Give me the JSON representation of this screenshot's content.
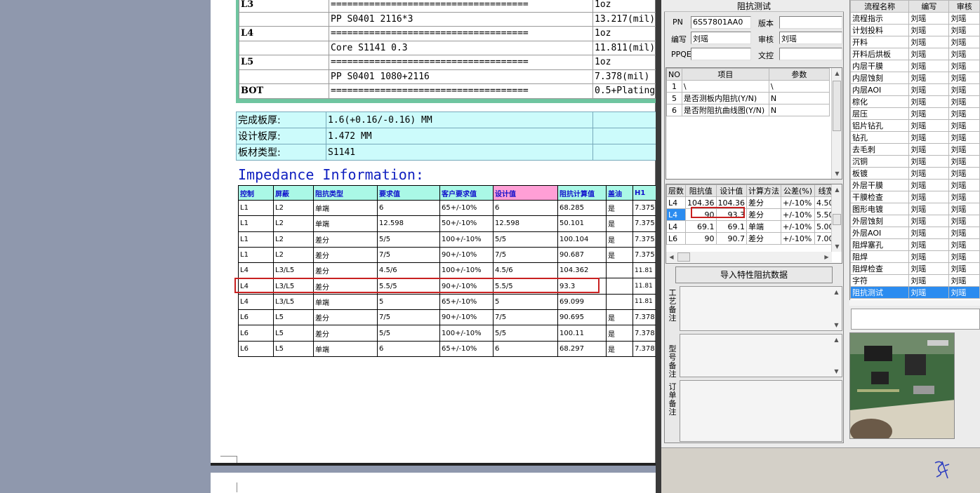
{
  "stackup": {
    "rows": [
      {
        "layer": "L3",
        "material": "====================================",
        "value": "1oz"
      },
      {
        "layer": "",
        "material": "PP     S0401    2116*3",
        "value": "13.217(mil)"
      },
      {
        "layer": "L4",
        "material": "====================================",
        "value": "1oz"
      },
      {
        "layer": "",
        "material": "Core     S1141     0.3",
        "value": "11.811(mil)"
      },
      {
        "layer": "L5",
        "material": "====================================",
        "value": "1oz"
      },
      {
        "layer": "",
        "material": "PP     S0401     1080+2116",
        "value": "7.378(mil)"
      },
      {
        "layer": "BOT",
        "material": "====================================",
        "value": "0.5+Plating"
      }
    ]
  },
  "thickness": {
    "rows": [
      {
        "label": "完成板厚:",
        "value": "1.6(+0.16/-0.16) MM"
      },
      {
        "label": "设计板厚:",
        "value": "1.472 MM"
      },
      {
        "label": "板材类型:",
        "value": "S1141"
      }
    ]
  },
  "impedance": {
    "title": "Impedance Information:",
    "headers": [
      "控制",
      "屏蔽",
      "阻抗类型",
      "要求值",
      "客户要求值",
      "设计值",
      "阻抗计算值",
      "盖油",
      "H1"
    ],
    "rows": [
      [
        "L1",
        "L2",
        "单端",
        "6",
        "65+/-10%",
        "6",
        "68.285",
        "是",
        "7.375"
      ],
      [
        "L1",
        "L2",
        "单端",
        "12.598",
        "50+/-10%",
        "12.598",
        "50.101",
        "是",
        "7.375"
      ],
      [
        "L1",
        "L2",
        "差分",
        "5/5",
        "100+/-10%",
        "5/5",
        "100.104",
        "是",
        "7.375"
      ],
      [
        "L1",
        "L2",
        "差分",
        "7/5",
        "90+/-10%",
        "7/5",
        "90.687",
        "是",
        "7.375"
      ],
      [
        "L4",
        "L3/L5",
        "差分",
        "4.5/6",
        "100+/-10%",
        "4.5/6",
        "104.362",
        "",
        "11.81"
      ],
      [
        "L4",
        "L3/L5",
        "差分",
        "5.5/5",
        "90+/-10%",
        "5.5/5",
        "93.3",
        "",
        "11.81"
      ],
      [
        "L4",
        "L3/L5",
        "单端",
        "5",
        "65+/-10%",
        "5",
        "69.099",
        "",
        "11.81"
      ],
      [
        "L6",
        "L5",
        "差分",
        "7/5",
        "90+/-10%",
        "7/5",
        "90.695",
        "是",
        "7.378"
      ],
      [
        "L6",
        "L5",
        "差分",
        "5/5",
        "100+/-10%",
        "5/5",
        "100.11",
        "是",
        "7.378"
      ],
      [
        "L6",
        "L5",
        "单端",
        "6",
        "65+/-10%",
        "6",
        "68.297",
        "是",
        "7.378"
      ]
    ]
  },
  "form": {
    "title": "阻抗测试",
    "pn_label": "PN",
    "pn_value": "6S57801AA0",
    "version_label": "版本",
    "version_value": "",
    "author_label": "编写",
    "author_value": "刘瑶",
    "review_label": "审核",
    "review_value": "刘瑶",
    "ppqe_label": "PPQE",
    "ppqe_value": "",
    "doc_label": "文控",
    "doc_value": ""
  },
  "params": {
    "headers": [
      "NO",
      "项目",
      "参数"
    ],
    "rows": [
      [
        "1",
        "\\",
        "\\"
      ],
      [
        "5",
        "是否测板内阻抗(Y/N)",
        "N"
      ],
      [
        "6",
        "是否附阻抗曲线图(Y/N)",
        "N"
      ]
    ]
  },
  "imp_grid": {
    "headers": [
      "层数",
      "阻抗值",
      "设计值",
      "计算方法",
      "公差(%)",
      "线宽"
    ],
    "rows": [
      [
        "L4",
        "104.36",
        "104.36",
        "差分",
        "+/-10%",
        "4.50"
      ],
      [
        "L4",
        "90",
        "93.3",
        "差分",
        "+/-10%",
        "5.50"
      ],
      [
        "L4",
        "69.1",
        "69.1",
        "单端",
        "+/-10%",
        "5.00"
      ],
      [
        "L6",
        "90",
        "90.7",
        "差分",
        "+/-10%",
        "7.00"
      ]
    ]
  },
  "import_button": "导入特性阻抗数据",
  "memo_labels": [
    "工艺备注",
    "型号备注",
    "订单备注"
  ],
  "process": {
    "headers": [
      "流程名称",
      "编写",
      "审核"
    ],
    "rows": [
      [
        "流程指示",
        "刘瑶",
        "刘瑶"
      ],
      [
        "计划投料",
        "刘瑶",
        "刘瑶"
      ],
      [
        "开料",
        "刘瑶",
        "刘瑶"
      ],
      [
        "开料后烘板",
        "刘瑶",
        "刘瑶"
      ],
      [
        "内层干膜",
        "刘瑶",
        "刘瑶"
      ],
      [
        "内层蚀刻",
        "刘瑶",
        "刘瑶"
      ],
      [
        "内层AOI",
        "刘瑶",
        "刘瑶"
      ],
      [
        "棕化",
        "刘瑶",
        "刘瑶"
      ],
      [
        "层压",
        "刘瑶",
        "刘瑶"
      ],
      [
        "铝片钻孔",
        "刘瑶",
        "刘瑶"
      ],
      [
        "钻孔",
        "刘瑶",
        "刘瑶"
      ],
      [
        "去毛刺",
        "刘瑶",
        "刘瑶"
      ],
      [
        "沉铜",
        "刘瑶",
        "刘瑶"
      ],
      [
        "板镀",
        "刘瑶",
        "刘瑶"
      ],
      [
        "外层干膜",
        "刘瑶",
        "刘瑶"
      ],
      [
        "干膜检查",
        "刘瑶",
        "刘瑶"
      ],
      [
        "图形电镀",
        "刘瑶",
        "刘瑶"
      ],
      [
        "外层蚀刻",
        "刘瑶",
        "刘瑶"
      ],
      [
        "外层AOI",
        "刘瑶",
        "刘瑶"
      ],
      [
        "阻焊塞孔",
        "刘瑶",
        "刘瑶"
      ],
      [
        "阻焊",
        "刘瑶",
        "刘瑶"
      ],
      [
        "阻焊检查",
        "刘瑶",
        "刘瑶"
      ],
      [
        "字符",
        "刘瑶",
        "刘瑶"
      ],
      [
        "阻抗测试",
        "刘瑶",
        "刘瑶"
      ]
    ],
    "selected_index": 23
  },
  "colors": {
    "highlight": "#c82020",
    "selection": "#2b8cf0",
    "stackup_border": "#6fc5a0",
    "cyan_cells": "#ccfbfb",
    "title_blue": "#1020c0"
  }
}
